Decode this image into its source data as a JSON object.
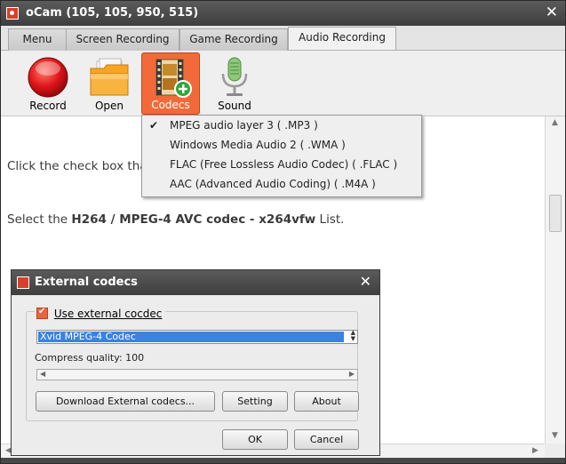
{
  "window": {
    "title": "oCam (105, 105, 950, 515)",
    "close_glyph": "✕"
  },
  "tabs": [
    {
      "label": "Menu"
    },
    {
      "label": "Screen Recording"
    },
    {
      "label": "Game Recording"
    },
    {
      "label": "Audio Recording",
      "active": true
    }
  ],
  "toolbar": {
    "record_label": "Record",
    "open_label": "Open",
    "codecs_label": "Codecs",
    "sound_label": "Sound"
  },
  "codec_menu": {
    "items": [
      {
        "label": "MPEG audio layer 3 ( .MP3 )",
        "checked": true
      },
      {
        "label": "Windows Media Audio 2 ( .WMA )"
      },
      {
        "label": "FLAC (Free Lossless Audio Codec) ( .FLAC )"
      },
      {
        "label": "AAC (Advanced Audio Coding) ( .M4A )"
      }
    ],
    "check_glyph": "✔"
  },
  "content": {
    "line1": "Click the check box that",
    "line2_prefix": "Select the ",
    "line2_bold": "H264 / MPEG-4 AVC codec - x264vfw",
    "line2_suffix": " List."
  },
  "dialog": {
    "title": "External codecs",
    "close_glyph": "✕",
    "checkbox_label": "Use external cocdec",
    "checkbox_checked": true,
    "selected_codec": "Xvid MPEG-4 Codec",
    "quality_label": "Compress quality: 100",
    "download_button": "Download External codecs...",
    "setting_button": "Setting",
    "about_button": "About",
    "ok_button": "OK",
    "cancel_button": "Cancel"
  },
  "colors": {
    "accent": "#f26a3a",
    "titlebar": "#4a4a4a",
    "selection": "#3b82e0"
  },
  "icons": [
    "record-icon",
    "folder-icon",
    "film-add-icon",
    "microphone-icon",
    "check-icon",
    "close-icon"
  ]
}
